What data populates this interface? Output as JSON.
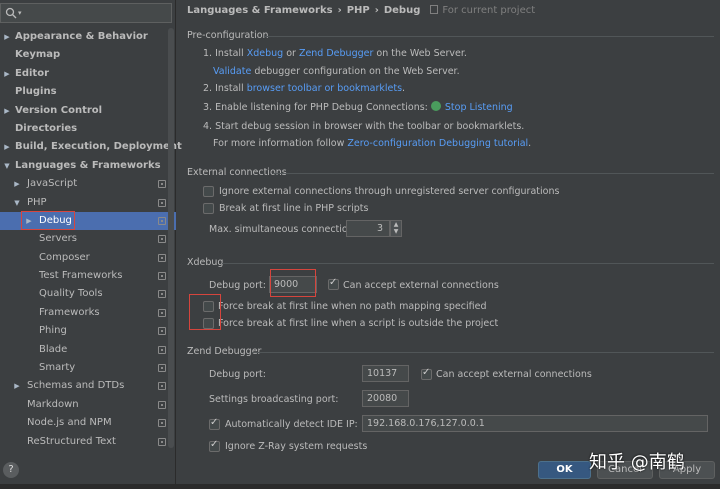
{
  "sidebar": {
    "items": [
      {
        "label": "Appearance & Behavior",
        "bold": true,
        "arrow": "▶",
        "level": 0
      },
      {
        "label": "Keymap",
        "bold": true,
        "arrow": "",
        "level": 0
      },
      {
        "label": "Editor",
        "bold": true,
        "arrow": "▶",
        "level": 0
      },
      {
        "label": "Plugins",
        "bold": true,
        "arrow": "",
        "level": 0
      },
      {
        "label": "Version Control",
        "bold": true,
        "arrow": "▶",
        "level": 0
      },
      {
        "label": "Directories",
        "bold": true,
        "arrow": "",
        "level": 0
      },
      {
        "label": "Build, Execution, Deployment",
        "bold": true,
        "arrow": "▶",
        "level": 0
      },
      {
        "label": "Languages & Frameworks",
        "bold": true,
        "arrow": "▼",
        "level": 0
      },
      {
        "label": "JavaScript",
        "bold": false,
        "arrow": "▶",
        "level": 1
      },
      {
        "label": "PHP",
        "bold": false,
        "arrow": "▼",
        "level": 1
      },
      {
        "label": "Debug",
        "bold": false,
        "arrow": "▶",
        "level": 2,
        "selected": true
      },
      {
        "label": "Servers",
        "bold": false,
        "arrow": "",
        "level": 2
      },
      {
        "label": "Composer",
        "bold": false,
        "arrow": "",
        "level": 2
      },
      {
        "label": "Test Frameworks",
        "bold": false,
        "arrow": "",
        "level": 2
      },
      {
        "label": "Quality Tools",
        "bold": false,
        "arrow": "",
        "level": 2
      },
      {
        "label": "Frameworks",
        "bold": false,
        "arrow": "",
        "level": 2
      },
      {
        "label": "Phing",
        "bold": false,
        "arrow": "",
        "level": 2
      },
      {
        "label": "Blade",
        "bold": false,
        "arrow": "",
        "level": 2
      },
      {
        "label": "Smarty",
        "bold": false,
        "arrow": "",
        "level": 2
      },
      {
        "label": "Schemas and DTDs",
        "bold": false,
        "arrow": "▶",
        "level": 1
      },
      {
        "label": "Markdown",
        "bold": false,
        "arrow": "",
        "level": 1
      },
      {
        "label": "Node.js and NPM",
        "bold": false,
        "arrow": "",
        "level": 1
      },
      {
        "label": "ReStructured Text",
        "bold": false,
        "arrow": "",
        "level": 1
      }
    ],
    "help_label": "?"
  },
  "breadcrumb": {
    "part1": "Languages & Frameworks",
    "sep": "›",
    "part2": "PHP",
    "part3": "Debug",
    "scope": "For current project"
  },
  "preconfig": {
    "title": "Pre-configuration",
    "step1_a": "1. Install ",
    "step1_xdebug": "Xdebug",
    "step1_or": " or ",
    "step1_zend": "Zend Debugger",
    "step1_b": " on the Web Server.",
    "validate_link": "Validate",
    "validate_rest": " debugger configuration on the Web Server.",
    "step2_a": "2. Install ",
    "step2_link": "browser toolbar or bookmarklets",
    "step2_b": ".",
    "step3_a": "3. Enable listening for PHP Debug Connections: ",
    "step3_link": "Stop Listening",
    "step4": "4. Start debug session in browser with the toolbar or bookmarklets.",
    "more_a": "For more information follow ",
    "more_link": "Zero-configuration Debugging tutorial",
    "more_b": "."
  },
  "external": {
    "title": "External connections",
    "ignore_label": "Ignore external connections through unregistered server configurations",
    "ignore_checked": false,
    "break_label": "Break at first line in PHP scripts",
    "break_checked": false,
    "max_label": "Max. simultaneous connections:",
    "max_value": "3"
  },
  "xdebug": {
    "title": "Xdebug",
    "port_label": "Debug port:",
    "port_value": "9000",
    "accept_label": "Can accept external connections",
    "accept_checked": true,
    "force_no_mapping": "Force break at first line when no path mapping specified",
    "force_no_mapping_checked": false,
    "force_outside": "Force break at first line when a script is outside the project",
    "force_outside_checked": false
  },
  "zend": {
    "title": "Zend Debugger",
    "port_label": "Debug port:",
    "port_value": "10137",
    "accept_label": "Can accept external connections",
    "accept_checked": true,
    "broadcast_label": "Settings broadcasting port:",
    "broadcast_value": "20080",
    "detect_label": "Automatically detect IDE IP:",
    "detect_checked": true,
    "detect_value": "192.168.0.176,127.0.0.1",
    "ignore_zray": "Ignore Z-Ray system requests",
    "ignore_zray_checked": true
  },
  "buttons": {
    "ok": "OK",
    "cancel": "Cancel",
    "apply": "Apply"
  },
  "watermark": "知乎 @南鹤",
  "colors": {
    "background": "#3c3f41",
    "selection": "#4b6eaf",
    "link": "#589df6",
    "highlight_box": "#d6453d"
  }
}
